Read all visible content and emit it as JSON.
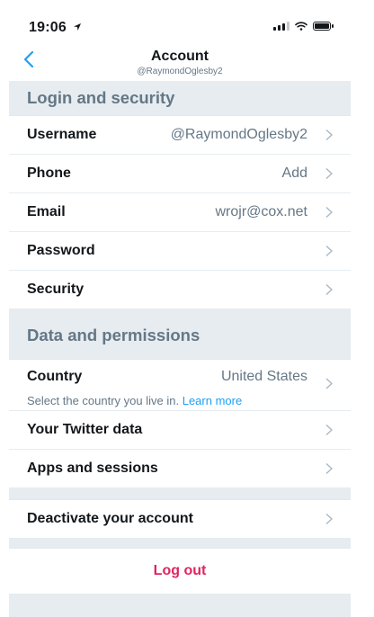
{
  "status_bar": {
    "time": "19:06"
  },
  "header": {
    "title": "Account",
    "subtitle": "@RaymondOglesby2"
  },
  "sections": {
    "login": {
      "title": "Login and security",
      "rows": [
        {
          "label": "Username",
          "value": "@RaymondOglesby2"
        },
        {
          "label": "Phone",
          "value": "Add"
        },
        {
          "label": "Email",
          "value": "wrojr@cox.net"
        },
        {
          "label": "Password",
          "value": ""
        },
        {
          "label": "Security",
          "value": ""
        }
      ]
    },
    "data": {
      "title": "Data and permissions",
      "country": {
        "label": "Country",
        "value": "United States",
        "helper": "Select the country you live in.",
        "learn_more": "Learn more"
      },
      "rows": [
        {
          "label": "Your Twitter data"
        },
        {
          "label": "Apps and sessions"
        }
      ]
    }
  },
  "deactivate": {
    "label": "Deactivate your account"
  },
  "logout": {
    "label": "Log out"
  },
  "colors": {
    "accent": "#1da1f2",
    "danger": "#e0245e",
    "section_bg": "#e6ecf0",
    "muted_text": "#657786"
  }
}
